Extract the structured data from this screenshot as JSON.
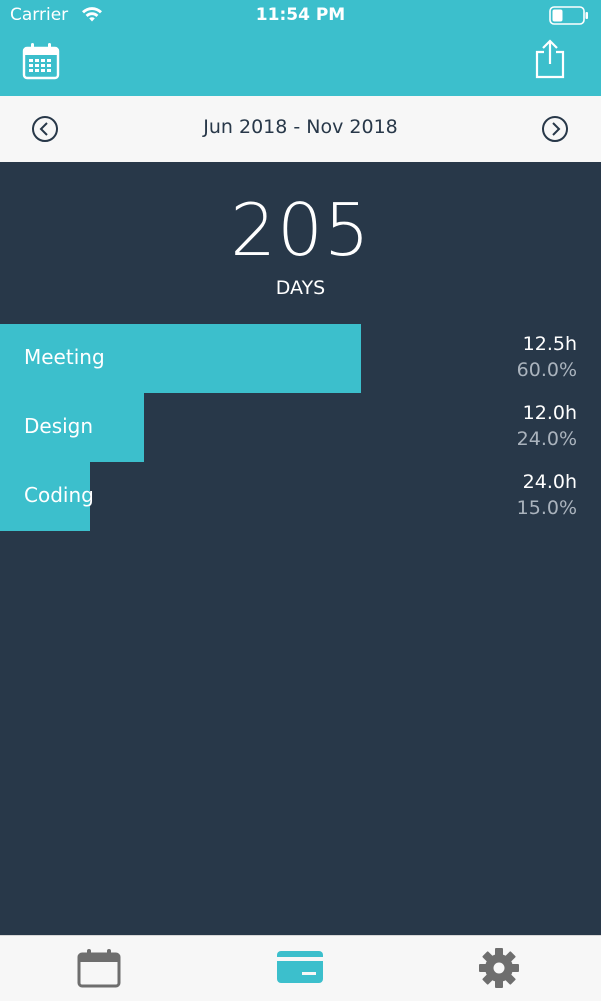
{
  "status_bar": {
    "carrier": "Carrier",
    "time": "11:54 PM",
    "battery_level": 0.35
  },
  "toolbar": {
    "left_icon": "calendar-grid-icon",
    "right_icon": "share-icon",
    "color": "#3cbfcc"
  },
  "date_nav": {
    "range": "Jun 2018 - Nov 2018",
    "prev_icon": "chevron-left-circle-icon",
    "next_icon": "chevron-right-circle-icon"
  },
  "summary": {
    "count": "205",
    "unit": "DAYS"
  },
  "categories": [
    {
      "name": "Meeting",
      "hours": "12.5h",
      "percent": "60.0%",
      "bar_fraction": 0.6
    },
    {
      "name": "Design",
      "hours": "12.0h",
      "percent": "24.0%",
      "bar_fraction": 0.24
    },
    {
      "name": "Coding",
      "hours": "24.0h",
      "percent": "15.0%",
      "bar_fraction": 0.15
    }
  ],
  "tab_bar": {
    "tabs": [
      {
        "icon": "calendar-icon",
        "selected": false
      },
      {
        "icon": "card-icon",
        "selected": true
      },
      {
        "icon": "gear-icon",
        "selected": false
      }
    ],
    "active_color": "#3cbfcc",
    "inactive_color": "#6e6e6e"
  },
  "colors": {
    "accent": "#3cbfcc",
    "background": "#283849",
    "muted_text": "#aab3bd"
  }
}
